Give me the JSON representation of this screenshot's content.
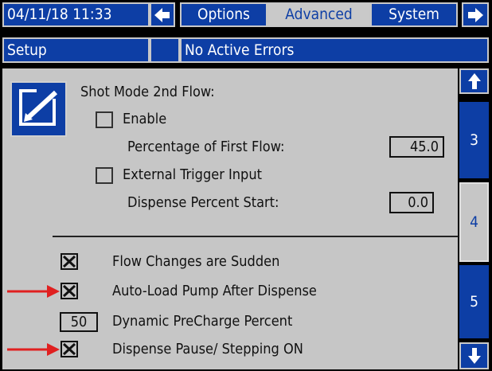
{
  "topbar": {
    "datetime": "04/11/18 11:33",
    "nav_left_icon": "arrow-left-icon",
    "tabs": [
      {
        "label": "Options",
        "active": false
      },
      {
        "label": "Advanced",
        "active": true
      },
      {
        "label": "System",
        "active": false
      }
    ],
    "nav_right_icon": "arrow-right-icon"
  },
  "statusbar": {
    "mode": "Setup",
    "errors": "No Active Errors"
  },
  "panel": {
    "edit_icon": "edit-pencil-icon",
    "shot_mode_title": "Shot Mode 2nd Flow:",
    "enable_label": "Enable",
    "enable_checked": false,
    "percentage_label": "Percentage of First Flow:",
    "percentage_value": "45.0",
    "external_trigger_label": "External Trigger Input",
    "external_trigger_checked": false,
    "dispense_start_label": "Dispense Percent Start:",
    "dispense_start_value": "0.0",
    "options": [
      {
        "label": "Flow Changes are Sudden",
        "checked": true,
        "annotated": false
      },
      {
        "label": "Auto-Load Pump After Dispense",
        "checked": true,
        "annotated": true
      },
      {
        "label": "Dynamic PreCharge Percent",
        "value": "50",
        "annotated": false
      },
      {
        "label": "Dispense Pause/ Stepping ON",
        "checked": true,
        "annotated": true
      }
    ]
  },
  "sidebar": {
    "up_icon": "arrow-up-icon",
    "pages": [
      {
        "label": "3",
        "active": false
      },
      {
        "label": "4",
        "active": true
      },
      {
        "label": "5",
        "active": false
      }
    ],
    "down_icon": "arrow-down-icon"
  },
  "colors": {
    "accent_blue": "#0d3ea5",
    "panel_grey": "#c6c6c6",
    "annotation_red": "#e02020"
  }
}
